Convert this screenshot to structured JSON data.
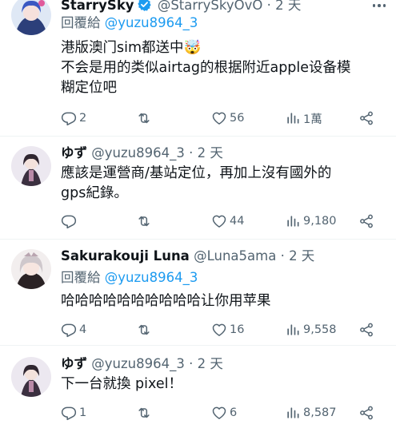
{
  "tweets": [
    {
      "name": "StarrySky",
      "verified": true,
      "handle": "@StarrySkyOvO",
      "dot": "·",
      "time": "2 天",
      "reply_prefix": "回覆給",
      "reply_to": "@yuzu8964_3",
      "text": "港版澳门sim都送中🤯\n不会是用的类似airtag的根据附近apple设备模\n糊定位吧",
      "replies": "2",
      "retweets": "",
      "likes": "56",
      "views": "1萬"
    },
    {
      "name": "ゆず",
      "verified": false,
      "handle": "@yuzu8964_3",
      "dot": "·",
      "time": "2 天",
      "text": "應該是運營商/基站定位，再加上沒有國外的\ngps紀錄。",
      "replies": "",
      "retweets": "",
      "likes": "44",
      "views": "9,180"
    },
    {
      "name": "Sakurakouji Luna",
      "verified": false,
      "handle": "@Luna5ama",
      "dot": "·",
      "time": "2 天",
      "reply_prefix": "回覆給",
      "reply_to": "@yuzu8964_3",
      "text": "哈哈哈哈哈哈哈哈哈哈让你用苹果",
      "replies": "4",
      "retweets": "",
      "likes": "16",
      "views": "9,558"
    },
    {
      "name": "ゆず",
      "verified": false,
      "handle": "@yuzu8964_3",
      "dot": "·",
      "time": "2 天",
      "text": "下一台就換 pixel！",
      "replies": "1",
      "retweets": "",
      "likes": "6",
      "views": "8,587"
    }
  ],
  "colors": {
    "text": "#0f1419",
    "secondary": "#536471",
    "link": "#1d9bf0",
    "verified": "#1d9bf0",
    "separator": "#eff3f4"
  },
  "icons": [
    "reply-icon",
    "retweet-icon",
    "like-icon",
    "views-icon",
    "share-icon",
    "more-icon",
    "verified-badge-icon"
  ]
}
